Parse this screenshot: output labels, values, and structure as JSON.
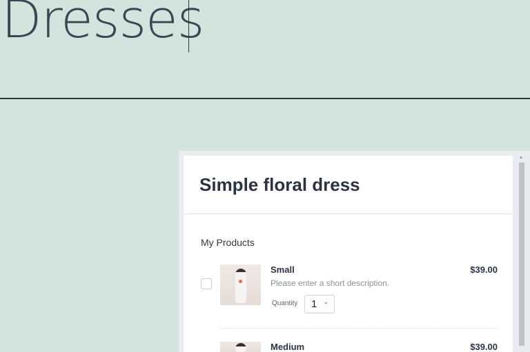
{
  "page": {
    "heading": "Dresses"
  },
  "card": {
    "title": "Simple floral dress",
    "section_label": "My Products",
    "quantity_label": "Quantity",
    "items": [
      {
        "name": "Small",
        "price": "$39.00",
        "description": "Please enter a short description.",
        "quantity": "1"
      },
      {
        "name": "Medium",
        "price": "$39.00"
      }
    ]
  }
}
